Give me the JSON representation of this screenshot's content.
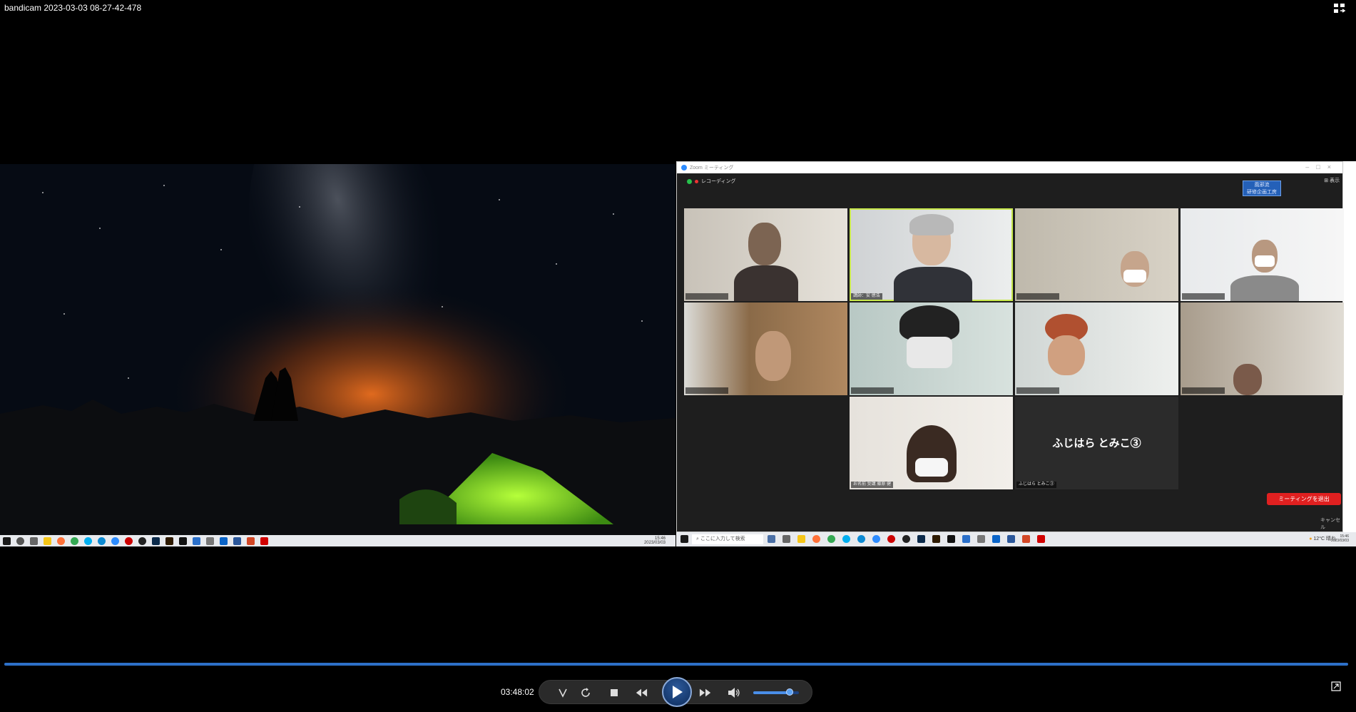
{
  "window": {
    "title": "bandicam 2023-03-03 08-27-42-478"
  },
  "left_desktop": {
    "taskbar_clock": [
      "15:46",
      "2023/03/03"
    ]
  },
  "zoom": {
    "window_title": "Zoom ミーティング",
    "recording_label": "レコーディング",
    "view_label": "表示",
    "name_tag": [
      "風邪流",
      "研修企画工房"
    ],
    "tiles": [
      {
        "label": ""
      },
      {
        "label": "講師：安 徳浩"
      },
      {
        "label": ""
      },
      {
        "label": ""
      },
      {
        "label": ""
      },
      {
        "label": ""
      },
      {
        "label": ""
      },
      {
        "label": ""
      },
      {
        "label": "お名前 受講 藤原 健"
      },
      {
        "label": "ふじはら とみこ③",
        "big_name": "ふじはら とみこ③"
      }
    ],
    "leave_button": "ミーティングを退出",
    "cancel_label": "キャンセル",
    "taskbar": {
      "search_placeholder": "ここに入力して検索",
      "weather": "12°C 晴れ",
      "clock": [
        "15:46",
        "2023/03/03"
      ]
    }
  },
  "player": {
    "elapsed_time": "03:48:02",
    "progress": 1.0,
    "volume": 0.8,
    "colors": {
      "accent": "#2d70c8",
      "play": "#1e4a8a"
    }
  }
}
